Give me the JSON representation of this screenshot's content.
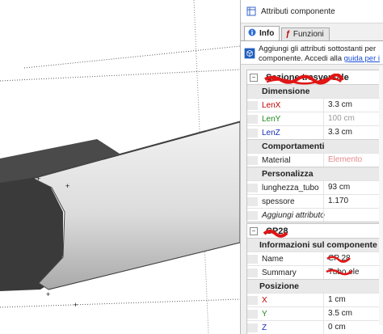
{
  "window": {
    "title": "Attributi componente"
  },
  "tabs": [
    {
      "label": "Info",
      "icon": "info-icon",
      "active": true
    },
    {
      "label": "Funzioni",
      "icon": "function-icon",
      "active": false
    }
  ],
  "infobar": {
    "line1": "Aggiungi gli attributi sottostanti per",
    "line2": "componente. Accedi alla ",
    "link": "guida per i"
  },
  "section1": {
    "name": "Sezione trasversale",
    "groups": [
      {
        "title": "Dimensione",
        "rows": [
          {
            "key": "LenX",
            "value": "3.3 cm",
            "color": "#c00000"
          },
          {
            "key": "LenY",
            "value": "100 cm",
            "color": "#1e8a1e"
          },
          {
            "key": "LenZ",
            "value": "3.3 cm",
            "color": "#1a2fb4"
          }
        ]
      },
      {
        "title": "Comportamenti",
        "rows": [
          {
            "key": "Material",
            "value": "Elemento"
          }
        ]
      },
      {
        "title": "Personalizza",
        "rows": [
          {
            "key": "lunghezza_tubo",
            "value": "93 cm"
          },
          {
            "key": "spessore",
            "value": "1.170"
          }
        ]
      }
    ],
    "add_attribute": "Aggiungi attributo"
  },
  "section2": {
    "name": "CP28",
    "groups": [
      {
        "title": "Informazioni sul componente",
        "rows": [
          {
            "key": "Name",
            "value": "CP 28"
          },
          {
            "key": "Summary",
            "value": "Tubo ele"
          }
        ]
      },
      {
        "title": "Posizione",
        "rows": [
          {
            "key": "X",
            "value": "1 cm",
            "color": "#c00000"
          },
          {
            "key": "Y",
            "value": "3.5 cm",
            "color": "#1e8a1e"
          },
          {
            "key": "Z",
            "value": "0 cm",
            "color": "#1a2fb4"
          }
        ]
      }
    ]
  }
}
